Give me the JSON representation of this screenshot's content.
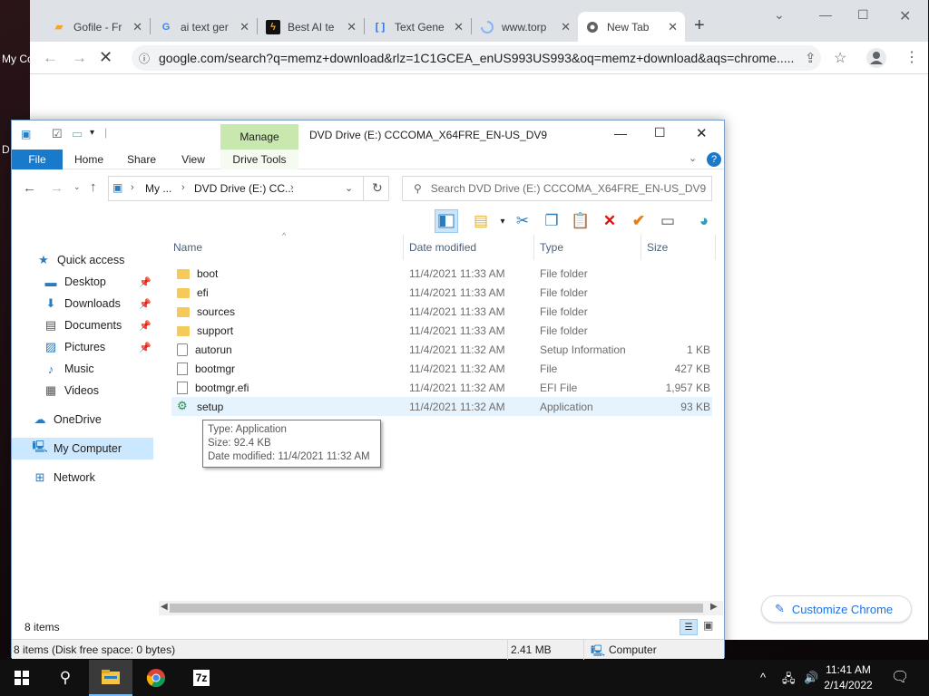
{
  "desktop": {
    "label_1": "My Co",
    "label_2": "D"
  },
  "chrome": {
    "tabs": [
      {
        "icon": "gofile-icon",
        "title": "Gofile - Fr"
      },
      {
        "icon": "google-icon",
        "title": "ai text ger"
      },
      {
        "icon": "bestai-icon",
        "title": "Best AI te"
      },
      {
        "icon": "textgen-icon",
        "title": "Text Gene"
      },
      {
        "icon": "loading-icon",
        "title": "www.torp"
      },
      {
        "icon": "chrome-icon",
        "title": "New Tab",
        "active": true
      }
    ],
    "new_tab": "+",
    "url": "google.com/search?q=memz+download&rlz=1C1GCEA_enUS993US993&oq=memz+download&aqs=chrome.....",
    "customize_label": "Customize Chrome"
  },
  "explorer": {
    "title": "DVD Drive (E:) CCCOMA_X64FRE_EN-US_DV9",
    "manage_label": "Manage",
    "ribbon_tabs": [
      "File",
      "Home",
      "Share",
      "View",
      "Drive Tools"
    ],
    "breadcrumb": [
      "My ...",
      "DVD Drive (E:) CC..."
    ],
    "search_placeholder": "Search DVD Drive (E:) CCCOMA_X64FRE_EN-US_DV9",
    "nav": [
      {
        "label": "Quick access",
        "icon": "star-icon"
      },
      {
        "label": "Desktop",
        "icon": "desktop-icon",
        "pinned": true
      },
      {
        "label": "Downloads",
        "icon": "download-icon",
        "pinned": true
      },
      {
        "label": "Documents",
        "icon": "documents-icon",
        "pinned": true
      },
      {
        "label": "Pictures",
        "icon": "pictures-icon",
        "pinned": true
      },
      {
        "label": "Music",
        "icon": "music-icon"
      },
      {
        "label": "Videos",
        "icon": "videos-icon"
      },
      {
        "label": "OneDrive",
        "icon": "cloud-icon"
      },
      {
        "label": "My Computer",
        "icon": "computer-icon",
        "selected": true
      },
      {
        "label": "Network",
        "icon": "network-icon"
      }
    ],
    "columns": [
      "Name",
      "Date modified",
      "Type",
      "Size"
    ],
    "files": [
      {
        "name": "boot",
        "date": "11/4/2021 11:33 AM",
        "type": "File folder",
        "size": "",
        "icon": "folder-icon"
      },
      {
        "name": "efi",
        "date": "11/4/2021 11:33 AM",
        "type": "File folder",
        "size": "",
        "icon": "folder-icon"
      },
      {
        "name": "sources",
        "date": "11/4/2021 11:33 AM",
        "type": "File folder",
        "size": "",
        "icon": "folder-icon"
      },
      {
        "name": "support",
        "date": "11/4/2021 11:33 AM",
        "type": "File folder",
        "size": "",
        "icon": "folder-icon"
      },
      {
        "name": "autorun",
        "date": "11/4/2021 11:32 AM",
        "type": "Setup Information",
        "size": "1 KB",
        "icon": "setup-info-icon"
      },
      {
        "name": "bootmgr",
        "date": "11/4/2021 11:32 AM",
        "type": "File",
        "size": "427 KB",
        "icon": "file-icon"
      },
      {
        "name": "bootmgr.efi",
        "date": "11/4/2021 11:32 AM",
        "type": "EFI File",
        "size": "1,957 KB",
        "icon": "file-icon"
      },
      {
        "name": "setup",
        "date": "11/4/2021 11:32 AM",
        "type": "Application",
        "size": "93 KB",
        "icon": "app-icon",
        "selected": true
      }
    ],
    "tooltip": {
      "type": "Type: Application",
      "size": "Size: 92.4 KB",
      "date": "Date modified: 11/4/2021 11:32 AM"
    },
    "item_count": "8 items",
    "status_left": "8 items (Disk free space: 0 bytes)",
    "status_size": "2.41 MB",
    "status_location": "Computer"
  },
  "taskbar": {
    "time": "11:41 AM",
    "date": "2/14/2022",
    "apps": [
      "file-explorer-icon",
      "chrome-icon",
      "7zip-icon"
    ],
    "seven_zip_label": "7z"
  }
}
